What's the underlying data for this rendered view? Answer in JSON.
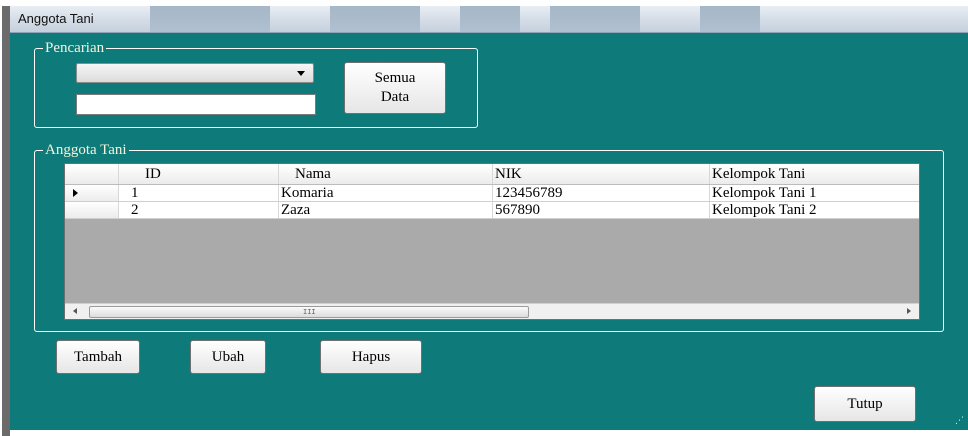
{
  "window": {
    "title": "Anggota Tani"
  },
  "search": {
    "legend": "Pencarian",
    "combo_value": "",
    "text_value": "",
    "all_button": "Semua\nData"
  },
  "grid": {
    "legend": "Anggota Tani",
    "columns": [
      "ID",
      "Nama",
      "NIK",
      "Kelompok Tani"
    ],
    "rows": [
      {
        "id": "1",
        "nama": "Komaria",
        "nik": "123456789",
        "kelompok": "Kelompok Tani 1"
      },
      {
        "id": "2",
        "nama": "Zaza",
        "nik": "567890",
        "kelompok": "Kelompok Tani 2"
      }
    ],
    "scroll_grip": "III"
  },
  "actions": {
    "tambah": "Tambah",
    "ubah": "Ubah",
    "hapus": "Hapus",
    "tutup": "Tutup"
  },
  "colors": {
    "window_bg": "#0e7a7a",
    "legend_text": "#f5f5dc",
    "grid_empty": "#aaaaaa"
  }
}
